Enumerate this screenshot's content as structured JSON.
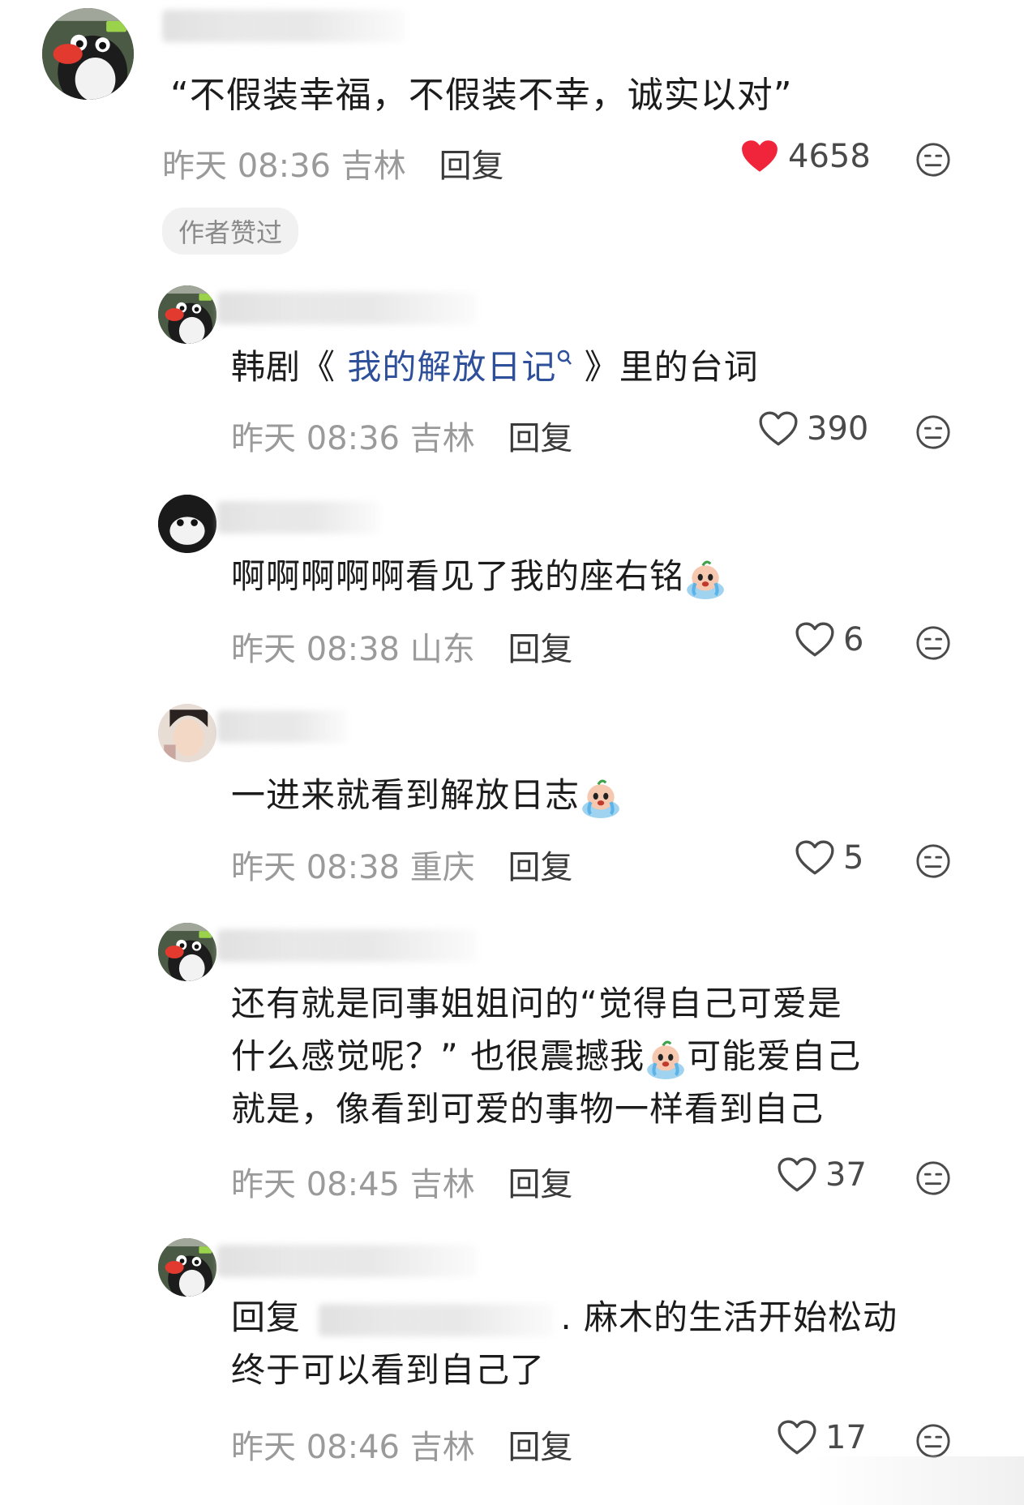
{
  "comments": [
    {
      "text": "“不假装幸福，不假装不幸，诚实以对”",
      "time": "昨天 08:36",
      "location": "吉林",
      "reply_label": "回复",
      "likes": "4658",
      "liked": true,
      "badge": "作者赞过"
    },
    {
      "text_before": "韩剧《 ",
      "link": "我的解放日记",
      "text_after": " 》里的台词",
      "time": "昨天 08:36",
      "location": "吉林",
      "reply_label": "回复",
      "likes": "390"
    },
    {
      "text": "啊啊啊啊啊看见了我的座右铭",
      "time": "昨天 08:38",
      "location": "山东",
      "reply_label": "回复",
      "likes": "6"
    },
    {
      "text": "一进来就看到解放日志",
      "time": "昨天 08:38",
      "location": "重庆",
      "reply_label": "回复",
      "likes": "5"
    },
    {
      "line1": "还有就是同事姐姐问的“觉得自己可爱是",
      "line2a": "什么感觉呢？” 也很震撼我",
      "line2b": "可能爱自己",
      "line3": "就是，像看到可爱的事物一样看到自己",
      "time": "昨天 08:45",
      "location": "吉林",
      "reply_label": "回复",
      "likes": "37"
    },
    {
      "prefix": "回复",
      "line1": ". 麻木的生活开始松动",
      "line2": "终于可以看到自己了",
      "time": "昨天 08:46",
      "location": "吉林",
      "reply_label": "回复",
      "likes": "17"
    }
  ],
  "colors": {
    "heart_liked": "#f0243b",
    "icon_gray": "#4a4a4a",
    "link": "#2e4f9a",
    "meta": "#9a9a9a"
  },
  "icons": [
    "heart-icon",
    "dislike-face-icon",
    "crying-emoji-icon",
    "link-search-icon"
  ]
}
